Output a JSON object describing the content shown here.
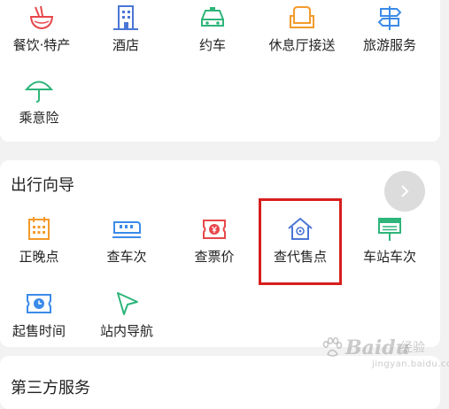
{
  "services": {
    "items": [
      {
        "label": "餐饮·特产",
        "icon": "noodle-bowl-icon",
        "color": "#e8474b"
      },
      {
        "label": "酒店",
        "icon": "hotel-building-icon",
        "color": "#4a76d6"
      },
      {
        "label": "约车",
        "icon": "car-icon",
        "color": "#2eb57a"
      },
      {
        "label": "休息厅接送",
        "icon": "sofa-icon",
        "color": "#f39a2b"
      },
      {
        "label": "旅游服务",
        "icon": "signpost-icon",
        "color": "#3b8be8"
      },
      {
        "label": "乘意险",
        "icon": "umbrella-icon",
        "color": "#2eb57a"
      }
    ]
  },
  "guide": {
    "title": "出行向导",
    "items": [
      {
        "label": "正晚点",
        "icon": "calendar-icon",
        "color": "#f39a2b"
      },
      {
        "label": "查车次",
        "icon": "train-icon",
        "color": "#3b8be8"
      },
      {
        "label": "查票价",
        "icon": "ticket-yen-icon",
        "color": "#e8474b"
      },
      {
        "label": "查代售点",
        "icon": "house-location-icon",
        "color": "#4a76d6"
      },
      {
        "label": "车站车次",
        "icon": "station-board-icon",
        "color": "#2eb57a"
      },
      {
        "label": "起售时间",
        "icon": "clock-ticket-icon",
        "color": "#3b8be8"
      },
      {
        "label": "站内导航",
        "icon": "navigation-arrow-icon",
        "color": "#2eb57a"
      }
    ]
  },
  "next_section": {
    "title": "第三方服务"
  },
  "watermark": {
    "brand": "Baidu",
    "sub": "经验",
    "url": "jingyan.baidu.com"
  }
}
